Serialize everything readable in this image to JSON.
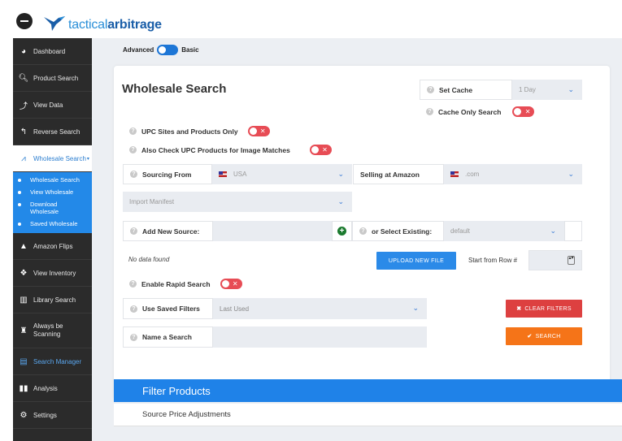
{
  "brand": {
    "logo_text_a": "tactical",
    "logo_text_b": "arbitrage"
  },
  "sidebar": {
    "items": [
      {
        "label": "Dashboard",
        "icon": "palette-icon"
      },
      {
        "label": "Product Search",
        "icon": "search-icon"
      },
      {
        "label": "View Data",
        "icon": "chart-line-icon"
      },
      {
        "label": "Reverse Search",
        "icon": "reply-icon"
      },
      {
        "label": "Wholesale Search",
        "icon": "area-chart-icon"
      }
    ],
    "wholesale_sub": [
      {
        "label": "Wholesale Search"
      },
      {
        "label": "View Wholesale"
      },
      {
        "label": "Download Wholesale"
      },
      {
        "label": "Saved Wholesale"
      }
    ],
    "items_after": [
      {
        "label": "Amazon Flips",
        "icon": "triangle-icon"
      },
      {
        "label": "View Inventory",
        "icon": "cubes-icon"
      },
      {
        "label": "Library Search",
        "icon": "books-icon"
      },
      {
        "label": "Always be Scanning",
        "icon": "trophy-icon"
      },
      {
        "label": "Search Manager",
        "icon": "list-icon"
      },
      {
        "label": "Analysis",
        "icon": "columns-icon"
      },
      {
        "label": "Settings",
        "icon": "gear-icon"
      }
    ]
  },
  "mode_toggle": {
    "left_label": "Advanced",
    "right_label": "Basic"
  },
  "form": {
    "title": "Wholesale Search",
    "set_cache_label": "Set Cache",
    "set_cache_value": "1 Day",
    "cache_only_label": "Cache Only Search",
    "upc_sites_label": "UPC Sites and Products Only",
    "upc_image_label": "Also Check UPC Products for Image Matches",
    "sourcing_from_label": "Sourcing From",
    "sourcing_from_value": "USA",
    "selling_at_label": "Selling at Amazon",
    "selling_at_value": ".com",
    "import_manifest_placeholder": "Import Manifest",
    "add_source_label": "Add New Source:",
    "select_existing_label": "or Select Existing:",
    "select_existing_value": "default",
    "no_data_text": "No data found",
    "upload_button": "UPLOAD NEW FILE",
    "start_row_label": "Start from Row #",
    "rapid_search_label": "Enable Rapid Search",
    "saved_filters_label": "Use Saved Filters",
    "saved_filters_value": "Last Used",
    "clear_filters_button": "CLEAR FILTERS",
    "name_search_label": "Name a Search",
    "search_button": "SEARCH"
  },
  "filter_section": {
    "title": "Filter Products",
    "first_row": "Source Price Adjustments"
  },
  "colors": {
    "accent_blue": "#1f82e8",
    "toggle_red": "#e74c55",
    "clear_red": "#dd4040",
    "search_orange": "#f57418",
    "sidebar_dark": "#2b2b2b"
  }
}
